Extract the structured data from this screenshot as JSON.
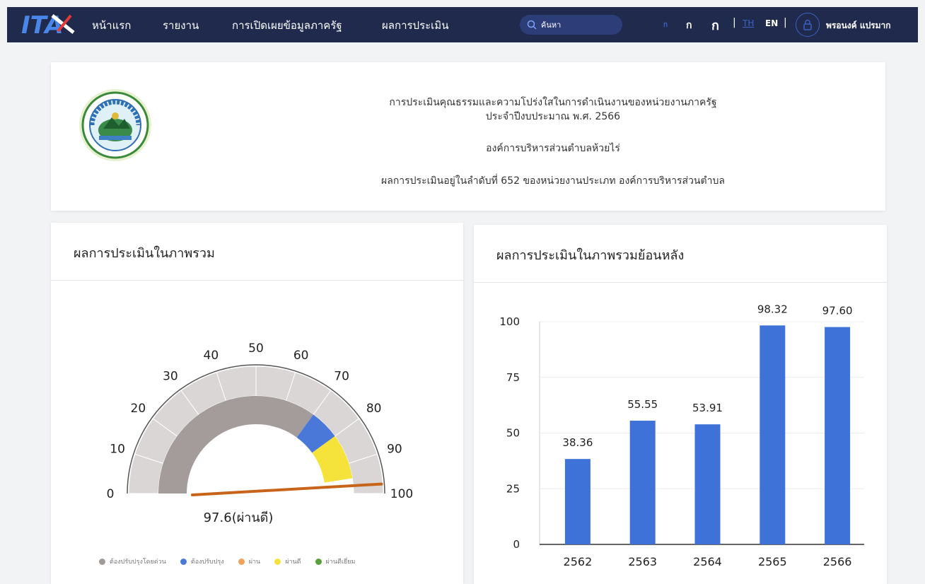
{
  "nav": {
    "logo_text": "ITA",
    "items": [
      "หน้าแรก",
      "รายงาน",
      "การเปิดเผยข้อมูลภาครัฐ",
      "ผลการประเมิน"
    ],
    "search_placeholder": "ค้นหา",
    "font_sizes": [
      "ก",
      "ก",
      "ก"
    ],
    "separator": "|",
    "lang_th": "TH",
    "lang_en": "EN",
    "user_name": "พรอนงค์ แปรมาก"
  },
  "header": {
    "title_line1": "การประเมินคุณธรรมและความโปร่งใสในการดำเนินงานของหน่วยงานภาครัฐ",
    "title_line2": "ประจำปีงบประมาณ พ.ศ. 2566",
    "org_name": "องค์การบริหารส่วนตำบลห้วยไร่",
    "rank_text": "ผลการประเมินอยู่ในลำดับที่ 652 ของหน่วยงานประเภท องค์การบริหารส่วนตำบล"
  },
  "gauge_panel": {
    "title": "ผลการประเมินในภาพรวม",
    "value": 97.6,
    "value_label": "97.6(ผ่านดี)",
    "ticks": [
      "0",
      "10",
      "20",
      "30",
      "40",
      "50",
      "60",
      "70",
      "80",
      "90",
      "100"
    ],
    "legend": [
      {
        "label": "ต้องปรับปรุงโดยด่วน",
        "color": "#a09a98"
      },
      {
        "label": "ต้องปรับปรุง",
        "color": "#4a78d8"
      },
      {
        "label": "ผ่าน",
        "color": "#f0a15a"
      },
      {
        "label": "ผ่านดี",
        "color": "#f5e23a"
      },
      {
        "label": "ผ่านดีเยี่ยม",
        "color": "#58a03a"
      }
    ]
  },
  "history_panel": {
    "title": "ผลการประเมินในภาพรวมย้อนหลัง"
  },
  "chart_data": {
    "type": "bar",
    "categories": [
      "2562",
      "2563",
      "2564",
      "2565",
      "2566"
    ],
    "values": [
      38.36,
      55.55,
      53.91,
      98.32,
      97.6
    ],
    "data_labels": [
      "38.36",
      "55.55",
      "53.91",
      "98.32",
      "97.60"
    ],
    "y_ticks": [
      "0",
      "25",
      "50",
      "75",
      "100"
    ],
    "ylim": [
      0,
      100
    ],
    "grid": true,
    "bar_color": "#3f72d8"
  }
}
